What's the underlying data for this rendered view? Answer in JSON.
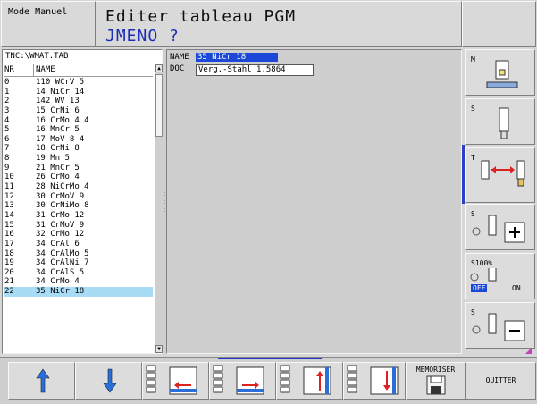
{
  "header": {
    "mode": "Mode Manuel",
    "title_line1": "Editer tableau PGM",
    "title_line2": "JMENO ?"
  },
  "table": {
    "path": "TNC:\\WMAT.TAB",
    "col_nr": "NR",
    "col_name": "NAME",
    "selected_index": 22,
    "rows": [
      {
        "nr": "0",
        "name": "110 WCrV 5"
      },
      {
        "nr": "1",
        "name": "14 NiCr 14"
      },
      {
        "nr": "2",
        "name": "142 WV 13"
      },
      {
        "nr": "3",
        "name": "15 CrNi 6"
      },
      {
        "nr": "4",
        "name": "16 CrMo 4 4"
      },
      {
        "nr": "5",
        "name": "16 MnCr 5"
      },
      {
        "nr": "6",
        "name": "17 MoV 8 4"
      },
      {
        "nr": "7",
        "name": "18 CrNi 8"
      },
      {
        "nr": "8",
        "name": "19 Mn 5"
      },
      {
        "nr": "9",
        "name": "21 MnCr 5"
      },
      {
        "nr": "10",
        "name": "26 CrMo 4"
      },
      {
        "nr": "11",
        "name": "28 NiCrMo 4"
      },
      {
        "nr": "12",
        "name": "30 CrMoV 9"
      },
      {
        "nr": "13",
        "name": "30 CrNiMo 8"
      },
      {
        "nr": "14",
        "name": "31 CrMo 12"
      },
      {
        "nr": "15",
        "name": "31 CrMoV 9"
      },
      {
        "nr": "16",
        "name": "32 CrMo 12"
      },
      {
        "nr": "17",
        "name": "34 CrAl 6"
      },
      {
        "nr": "18",
        "name": "34 CrAlMo 5"
      },
      {
        "nr": "19",
        "name": "34 CrAlNi 7"
      },
      {
        "nr": "20",
        "name": "34 CrAlS 5"
      },
      {
        "nr": "21",
        "name": "34 CrMo 4"
      },
      {
        "nr": "22",
        "name": "35 NiCr 18"
      }
    ]
  },
  "form": {
    "name_label": "NAME",
    "name_value": "35 NiCr 18",
    "doc_label": "DOC",
    "doc_value": "Verg.-Stahl 1.5864"
  },
  "side_keys": {
    "m": "M",
    "s1": "S",
    "t": "T",
    "s_plus": "S",
    "s100": "S100%",
    "off": "OFF",
    "on": "ON",
    "s_minus": "S"
  },
  "softkeys": {
    "memoriser": "MEMORISER",
    "quitter": "QUITTER"
  },
  "colors": {
    "accent_blue": "#1b2eb5",
    "selection": "#a8dcf5",
    "highlight": "#1b48d8"
  }
}
